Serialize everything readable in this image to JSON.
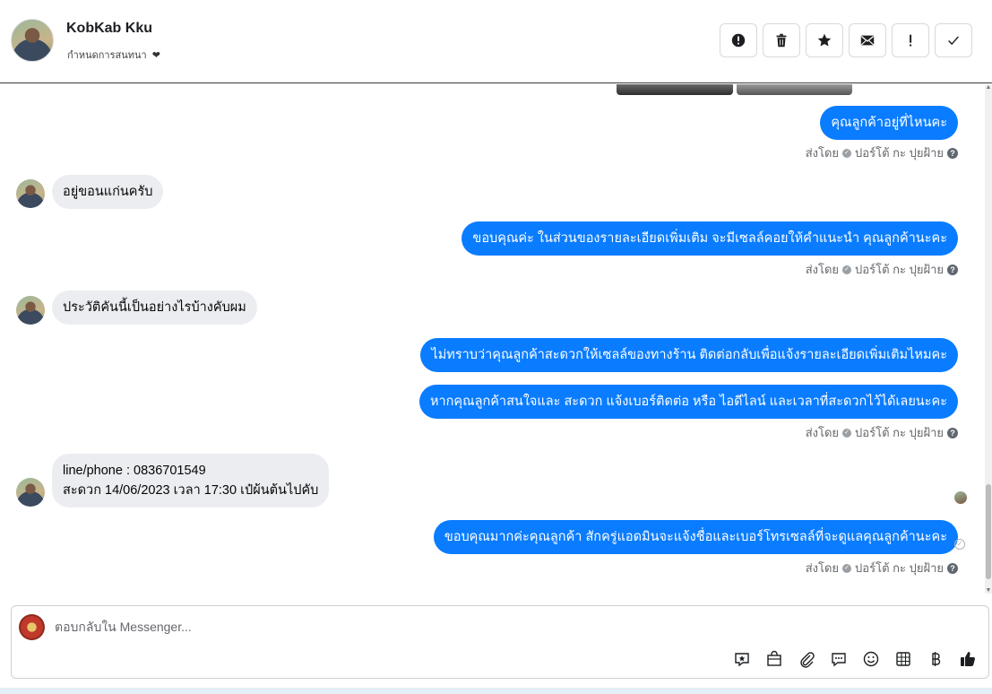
{
  "header": {
    "contact_name": "KobKab Kku",
    "assign_label": "กำหนดการสนทนา",
    "actions": [
      {
        "name": "spam-report-button",
        "icon": "alert-circle-icon"
      },
      {
        "name": "delete-button",
        "icon": "trash-icon"
      },
      {
        "name": "star-button",
        "icon": "star-icon"
      },
      {
        "name": "mark-unread-button",
        "icon": "envelope-icon"
      },
      {
        "name": "follow-up-button",
        "icon": "exclamation-icon"
      },
      {
        "name": "mark-done-button",
        "icon": "check-icon"
      }
    ]
  },
  "messages": [
    {
      "dir": "out",
      "text": "คุณลูกค้าอยู่ที่ไหนคะ"
    },
    {
      "dir": "meta",
      "sent_by": "ส่งโดย",
      "agent": "ปอร์โต้ กะ ปุยฝ้าย"
    },
    {
      "dir": "in",
      "text": "อยู่ขอนแก่นครับ"
    },
    {
      "dir": "out",
      "text": "ขอบคุณค่ะ  ในส่วนของรายละเอียดเพิ่มเติม จะมีเซลล์คอยให้คำแนะนำ คุณลูกค้านะคะ"
    },
    {
      "dir": "meta",
      "sent_by": "ส่งโดย",
      "agent": "ปอร์โต้ กะ ปุยฝ้าย"
    },
    {
      "dir": "in",
      "text": "ประวัติคันนี้เป็นอย่างไรบ้างคับผม"
    },
    {
      "dir": "out",
      "text": "ไม่ทราบว่าคุณลูกค้าสะดวกให้เซลล์ของทางร้าน ติดต่อกลับเพื่อแจ้งรายละเอียดเพิ่มเติมไหมคะ"
    },
    {
      "dir": "out",
      "text": "หากคุณลูกค้าสนใจและ สะดวก แจ้งเบอร์ติดต่อ หรือ ไอดีไลน์ และเวลาที่สะดวกไว้ได้เลยนะคะ"
    },
    {
      "dir": "meta",
      "sent_by": "ส่งโดย",
      "agent": "ปอร์โต้ กะ ปุยฝ้าย"
    },
    {
      "dir": "in",
      "line1": "line/phone : 0836701549",
      "line2": "สะดวก 14/06/2023 เวลา 17:30 เป๋ผ้นต้นไปคับ"
    },
    {
      "dir": "out",
      "text": "ขอบคุณมากค่ะคุณลูกค้า  สักครู่แอดมินจะแจ้งชื่อและเบอร์โทรเซลล์ที่จะดูแลคุณลูกค้านะคะ"
    },
    {
      "dir": "meta",
      "sent_by": "ส่งโดย",
      "agent": "ปอร์โต้ กะ ปุยฝ้าย"
    }
  ],
  "composer": {
    "placeholder": "ตอบกลับใน Messenger...",
    "tools": [
      "sticker-icon",
      "shopping-bag-icon",
      "paperclip-icon",
      "saved-reply-icon",
      "emoji-icon",
      "table-icon",
      "baht-icon",
      "like-icon"
    ]
  },
  "colors": {
    "outgoing_bubble": "#0a7cff",
    "incoming_bubble": "#ebedf0",
    "meta_text": "#65676b"
  }
}
